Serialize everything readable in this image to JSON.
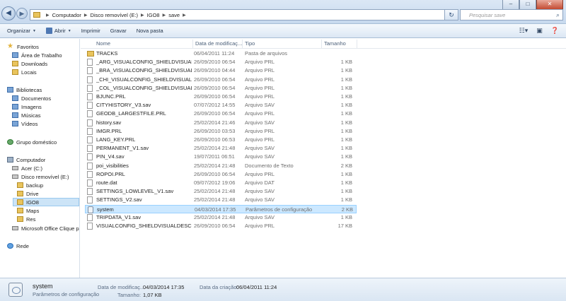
{
  "window": {
    "minimize": "–",
    "maximize": "□",
    "close": "✕"
  },
  "address": {
    "crumbs": [
      "Computador",
      "Disco removível (E:)",
      "IGO8",
      "save"
    ]
  },
  "search": {
    "placeholder": "Pesquisar save"
  },
  "toolbar": {
    "organize": "Organizar",
    "open": "Abrir",
    "print": "Imprimir",
    "burn": "Gravar",
    "new_folder": "Nova pasta"
  },
  "nav": {
    "favorites": "Favoritos",
    "desktop": "Área de Trabalho",
    "downloads": "Downloads",
    "places": "Locais",
    "libraries": "Bibliotecas",
    "documents": "Documentos",
    "images": "Imagens",
    "music": "Músicas",
    "videos": "Vídeos",
    "homegroup": "Grupo doméstico",
    "computer": "Computador",
    "acer": "Acer (C:)",
    "removable": "Disco removível (E:)",
    "backup": "backup",
    "drive": "Drive",
    "igo8": "IGO8",
    "maps": "Maps",
    "res": "Res",
    "office": "Microsoft Office Clique pa",
    "network": "Rede"
  },
  "columns": {
    "name": "Nome",
    "date": "Data de modificaç...",
    "type": "Tipo",
    "size": "Tamanho"
  },
  "files": [
    {
      "name": "TRACKS",
      "date": "06/04/2011 11:24",
      "type": "Pasta de arquivos",
      "size": "",
      "icon": "folder"
    },
    {
      "name": "_ARG_VISUALCONFIG_SHIELDVISUALDES...",
      "date": "26/09/2010 06:54",
      "type": "Arquivo PRL",
      "size": "1 KB",
      "icon": "doc"
    },
    {
      "name": "_BRA_VISUALCONFIG_SHIELDVISUALDES...",
      "date": "26/09/2010 04:44",
      "type": "Arquivo PRL",
      "size": "1 KB",
      "icon": "doc"
    },
    {
      "name": "_CHI_VISUALCONFIG_SHIELDVISUALDES...",
      "date": "26/09/2010 06:54",
      "type": "Arquivo PRL",
      "size": "1 KB",
      "icon": "doc"
    },
    {
      "name": "_COL_VISUALCONFIG_SHIELDVISUALDES...",
      "date": "26/09/2010 06:54",
      "type": "Arquivo PRL",
      "size": "1 KB",
      "icon": "doc"
    },
    {
      "name": "BJUNC.PRL",
      "date": "26/09/2010 06:54",
      "type": "Arquivo PRL",
      "size": "1 KB",
      "icon": "doc"
    },
    {
      "name": "CITYHISTORY_V3.sav",
      "date": "07/07/2012 14:55",
      "type": "Arquivo SAV",
      "size": "1 KB",
      "icon": "doc"
    },
    {
      "name": "GEODB_LARGESTFILE.PRL",
      "date": "26/09/2010 06:54",
      "type": "Arquivo PRL",
      "size": "1 KB",
      "icon": "doc"
    },
    {
      "name": "history.sav",
      "date": "25/02/2014 21:46",
      "type": "Arquivo SAV",
      "size": "1 KB",
      "icon": "doc"
    },
    {
      "name": "IMGR.PRL",
      "date": "26/09/2010 03:53",
      "type": "Arquivo PRL",
      "size": "1 KB",
      "icon": "doc"
    },
    {
      "name": "LANG_KEY.PRL",
      "date": "26/09/2010 06:53",
      "type": "Arquivo PRL",
      "size": "1 KB",
      "icon": "doc"
    },
    {
      "name": "PERMANENT_V1.sav",
      "date": "25/02/2014 21:48",
      "type": "Arquivo SAV",
      "size": "1 KB",
      "icon": "doc"
    },
    {
      "name": "PIN_V4.sav",
      "date": "19/07/2011 06:51",
      "type": "Arquivo SAV",
      "size": "1 KB",
      "icon": "doc"
    },
    {
      "name": "poi_visibilities",
      "date": "25/02/2014 21:48",
      "type": "Documento de Texto",
      "size": "2 KB",
      "icon": "doc"
    },
    {
      "name": "ROPOI.PRL",
      "date": "26/09/2010 06:54",
      "type": "Arquivo PRL",
      "size": "1 KB",
      "icon": "doc"
    },
    {
      "name": "route.dat",
      "date": "09/07/2012 19:06",
      "type": "Arquivo DAT",
      "size": "1 KB",
      "icon": "doc"
    },
    {
      "name": "SETTINGS_LOWLEVEL_V1.sav",
      "date": "25/02/2014 21:48",
      "type": "Arquivo SAV",
      "size": "1 KB",
      "icon": "doc"
    },
    {
      "name": "SETTINGS_V2.sav",
      "date": "25/02/2014 21:48",
      "type": "Arquivo SAV",
      "size": "1 KB",
      "icon": "doc"
    },
    {
      "name": "system",
      "date": "04/03/2014 17:35",
      "type": "Parâmetros de configuração",
      "size": "2 KB",
      "icon": "cfg",
      "selected": true
    },
    {
      "name": "TRIPDATA_V1.sav",
      "date": "25/02/2014 21:48",
      "type": "Arquivo SAV",
      "size": "1 KB",
      "icon": "doc"
    },
    {
      "name": "VISUALCONFIG_SHIELDVISUALDESC.PRL",
      "date": "26/09/2010 06:54",
      "type": "Arquivo PRL",
      "size": "17 KB",
      "icon": "doc"
    }
  ],
  "details": {
    "name": "system",
    "type": "Parâmetros de configuração",
    "modified_label": "Data de modificaç...",
    "modified_value": "04/03/2014 17:35",
    "size_label": "Tamanho:",
    "size_value": "1,07 KB",
    "created_label": "Data da criação:",
    "created_value": "06/04/2011 11:24"
  }
}
